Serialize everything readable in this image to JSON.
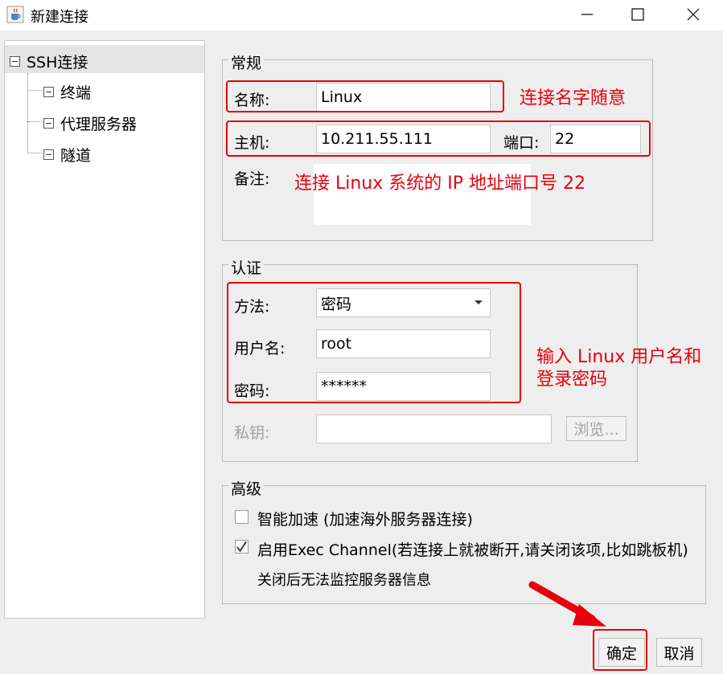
{
  "window": {
    "title": "新建连接",
    "app_icon": "java-cup-icon"
  },
  "tree": {
    "root": "SSH连接",
    "children": [
      "终端",
      "代理服务器",
      "隧道"
    ]
  },
  "general": {
    "legend": "常规",
    "name_label": "名称:",
    "name_value": "Linux",
    "host_label": "主机:",
    "host_value": "10.211.55.111",
    "port_label": "端口:",
    "port_value": "22",
    "note_label": "备注:",
    "note_value": ""
  },
  "auth": {
    "legend": "认证",
    "method_label": "方法:",
    "method_value": "密码",
    "username_label": "用户名:",
    "username_value": "root",
    "password_label": "密码:",
    "password_value": "******",
    "privkey_label": "私钥:",
    "privkey_value": "",
    "browse_label": "浏览..."
  },
  "advanced": {
    "legend": "高级",
    "accel_label": "智能加速 (加速海外服务器连接)",
    "accel_checked": false,
    "exec_label": "启用Exec Channel(若连接上就被断开,请关闭该项,比如跳板机)",
    "exec_checked": true,
    "exec_note": "关闭后无法监控服务器信息"
  },
  "buttons": {
    "ok": "确定",
    "cancel": "取消"
  },
  "annotations": {
    "name_hint": "连接名字随意",
    "host_hint": "连接 Linux 系统的 IP 地址端口号 22",
    "auth_hint_line1": "输入 Linux 用户名和",
    "auth_hint_line2": "登录密码",
    "color": "#e8000b"
  }
}
